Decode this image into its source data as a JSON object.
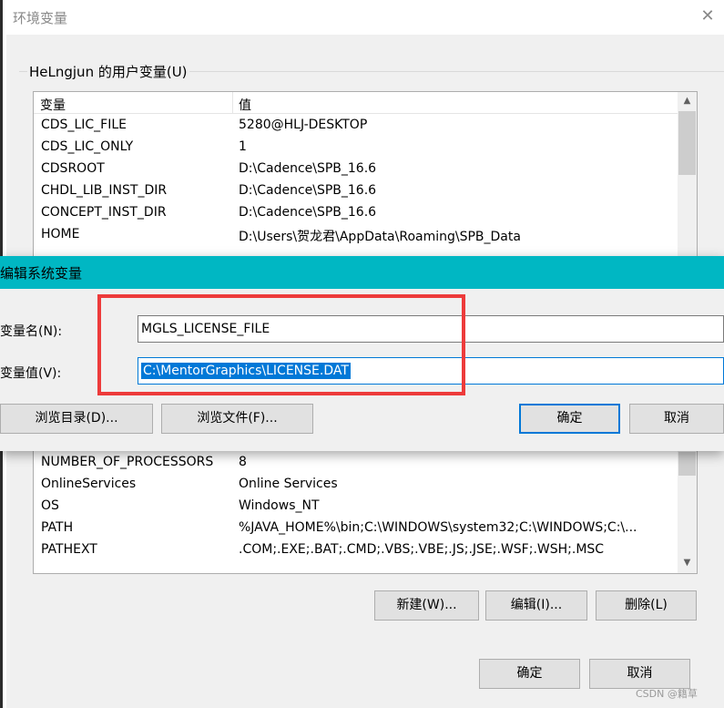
{
  "env_dialog": {
    "title": "环境变量",
    "close_glyph": "✕",
    "user_group_label": "HeLngjun 的用户变量(U)",
    "columns": [
      "变量",
      "值"
    ],
    "rows_top": [
      {
        "name": "CDS_LIC_FILE",
        "value": "5280@HLJ-DESKTOP"
      },
      {
        "name": "CDS_LIC_ONLY",
        "value": "1"
      },
      {
        "name": "CDSROOT",
        "value": "D:\\Cadence\\SPB_16.6"
      },
      {
        "name": "CHDL_LIB_INST_DIR",
        "value": "D:\\Cadence\\SPB_16.6"
      },
      {
        "name": "CONCEPT_INST_DIR",
        "value": "D:\\Cadence\\SPB_16.6"
      },
      {
        "name": "HOME",
        "value": "D:\\Users\\贺龙君\\AppData\\Roaming\\SPB_Data"
      }
    ],
    "rows_bottom": [
      {
        "name": "NUMBER_OF_PROCESSORS",
        "value": "8"
      },
      {
        "name": "OnlineServices",
        "value": "Online Services"
      },
      {
        "name": "OS",
        "value": "Windows_NT"
      },
      {
        "name": "PATH",
        "value": "%JAVA_HOME%\\bin;C:\\WINDOWS\\system32;C:\\WINDOWS;C:\\..."
      },
      {
        "name": "PATHEXT",
        "value": ".COM;.EXE;.BAT;.CMD;.VBS;.VBE;.JS;.JSE;.WSF;.WSH;.MSC"
      }
    ],
    "buttons": {
      "new": "新建(W)...",
      "edit": "编辑(I)...",
      "delete": "删除(L)",
      "ok": "确定",
      "cancel": "取消"
    },
    "scroll_up": "▲",
    "scroll_down": "▼"
  },
  "edit_dialog": {
    "title": "编辑系统变量",
    "name_label": "变量名(N):",
    "value_label": "变量值(V):",
    "name_value": "MGLS_LICENSE_FILE",
    "value_value": "C:\\MentorGraphics\\LICENSE.DAT",
    "browse_dir": "浏览目录(D)...",
    "browse_file": "浏览文件(F)...",
    "ok": "确定",
    "cancel": "取消"
  },
  "watermark": "CSDN @籍草",
  "colors": {
    "edit_titlebar": "#00b7c3",
    "highlight_box": "#ed3b3b",
    "selection": "#0078d7"
  }
}
